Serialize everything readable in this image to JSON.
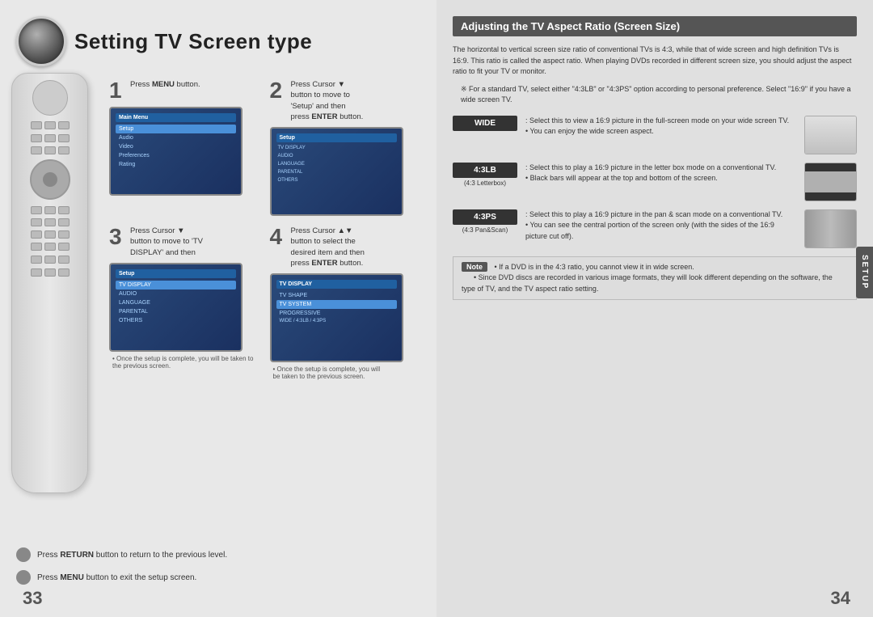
{
  "page_left": {
    "page_number": "33",
    "title": "Setting TV Screen type",
    "steps": [
      {
        "number": "1",
        "instruction": "Press <strong>MENU</strong> button.",
        "instruction_plain": "Press MENU button."
      },
      {
        "number": "2",
        "instruction": "Press Cursor ▼ button to move to 'Setup' and then press <strong>ENTER</strong> button.",
        "instruction_plain": "Press Cursor ▼ button to move to 'Setup' and then press ENTER button."
      },
      {
        "number": "3",
        "instruction": "Press Cursor ▼ button to move to 'TV DISPLAY' and then",
        "instruction_plain": "Press Cursor ▼ button to move to 'TV DISPLAY' and then"
      },
      {
        "number": "4",
        "instruction": "Press Cursor ▲▼ button to select the desired item and then press <strong>ENTER</strong> button.",
        "instruction_plain": "Press Cursor ▲▼ button to select the desired item and then press ENTER button."
      }
    ],
    "step_note": "• Once the setup is complete, you will be taken to the previous screen.",
    "bottom_notes": [
      {
        "text": "Press <strong>RETURN</strong> button to return to the previous level."
      },
      {
        "text": "Press <strong>MENU</strong> button to exit the setup screen."
      }
    ]
  },
  "page_right": {
    "page_number": "34",
    "section_title": "Adjusting the TV Aspect Ratio (Screen Size)",
    "description": "The horizontal to vertical screen size ratio of conventional TVs is 4:3, while that of wide screen and high definition TVs is 16:9. This ratio is called the aspect ratio. When playing DVDs recorded in different screen size, you should adjust the aspect ratio to fit your TV or monitor.",
    "note_star": "※ For a standard TV, select either \"4:3LB\" or \"4:3PS\" option according to personal preference. Select \"16:9\" if you have a wide screen TV.",
    "options": [
      {
        "badge": "WIDE",
        "badge_sub": "",
        "description": ": Select this to view a 16:9 picture in the full-screen mode on your wide screen TV.\n• You can enjoy the wide screen aspect."
      },
      {
        "badge": "4:3LB",
        "badge_sub": "(4:3 Letterbox)",
        "description": ": Select this to play a 16:9 picture in the letter box mode on a conventional TV.\n• Black bars will appear at the top and bottom of the screen."
      },
      {
        "badge": "4:3PS",
        "badge_sub": "(4:3 Pan&Scan)",
        "description": ": Select this to play a 16:9 picture in the pan & scan mode on a conventional TV.\n• You can see the central portion of the screen only (with the sides of the 16:9 picture cut off)."
      }
    ],
    "note_items": [
      "• If a DVD is in the 4:3 ratio, you cannot view it in wide screen.",
      "• Since DVD discs are recorded in various image formats, they will look different depending on the software, the type of TV, and the TV aspect ratio setting."
    ],
    "setup_tab": "SETUP"
  },
  "icons": {
    "cursor_down": "▼",
    "cursor_updown": "▲▼"
  }
}
